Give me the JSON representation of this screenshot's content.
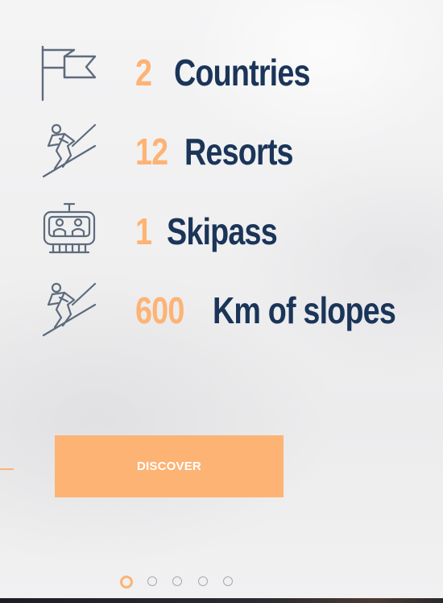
{
  "stats": [
    {
      "number": "2",
      "label": "Countries",
      "icon": "flag-icon"
    },
    {
      "number": "12",
      "label": "Resorts",
      "icon": "skier-icon"
    },
    {
      "number": "1",
      "label": "Skipass",
      "icon": "cable-car-icon"
    },
    {
      "number": "600",
      "label": "Km of slopes",
      "icon": "skier-icon"
    }
  ],
  "cta": {
    "label": "DISCOVER"
  },
  "pagination": {
    "count": 5,
    "active": 1
  },
  "colors": {
    "accent": "#fdb374",
    "navy": "#1b3559",
    "icon": "#5d6b7c",
    "dot": "#a9a9ad"
  }
}
